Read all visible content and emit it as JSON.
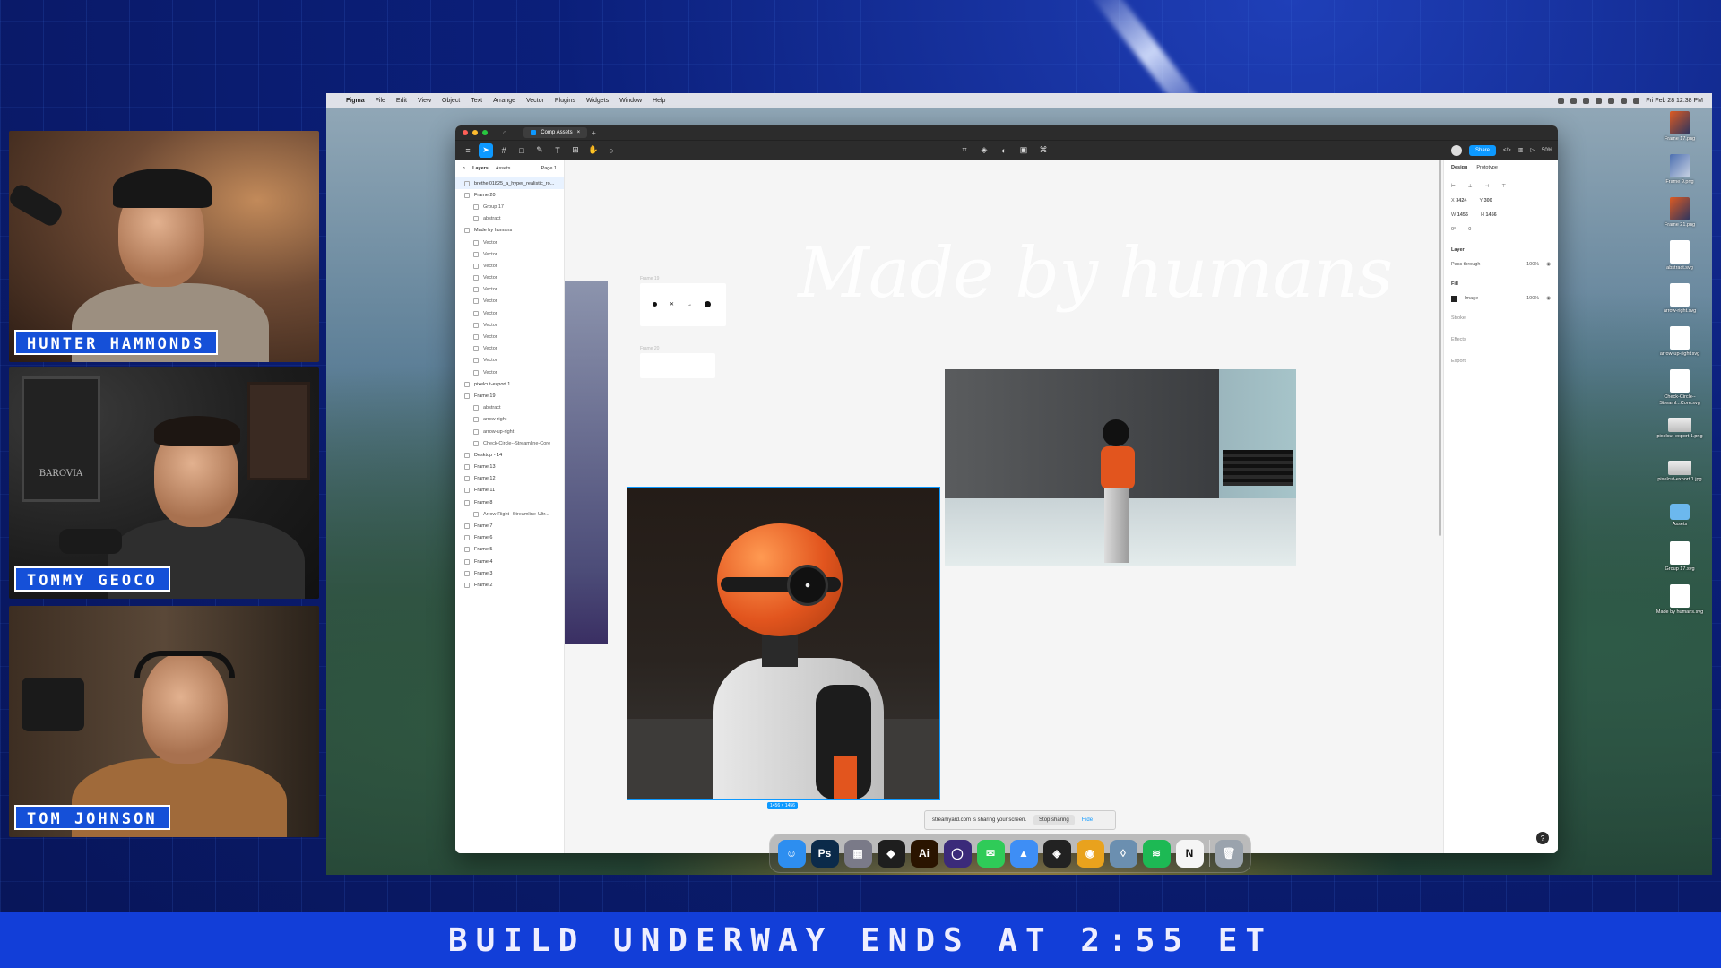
{
  "banner": {
    "text": "BUILD UNDERWAY ENDS AT 2:55 ET"
  },
  "cams": [
    {
      "name": "HUNTER HAMMONDS"
    },
    {
      "name": "TOMMY GEOCO"
    },
    {
      "name": "TOM JOHNSON"
    }
  ],
  "cam_props": {
    "barovia_poster": "BAROVIA"
  },
  "mac_menubar": {
    "app": "Figma",
    "items": [
      "File",
      "Edit",
      "View",
      "Object",
      "Text",
      "Arrange",
      "Vector",
      "Plugins",
      "Widgets",
      "Window",
      "Help"
    ],
    "clock": "Fri Feb 28 12:38 PM"
  },
  "figma": {
    "tab_title": "Comp Assets",
    "share_label": "Share",
    "zoom": "50%",
    "layers_panel": {
      "tabs": [
        "Layers",
        "Assets"
      ],
      "page": "Page 1",
      "rows": [
        {
          "label": "brethel01825_a_hyper_realistic_ro...",
          "level": 0,
          "selected": true
        },
        {
          "label": "Frame 20",
          "level": 0
        },
        {
          "label": "Group 17",
          "level": 1
        },
        {
          "label": "abstract",
          "level": 1
        },
        {
          "label": "Made by humans",
          "level": 0
        },
        {
          "label": "Vector",
          "level": 1
        },
        {
          "label": "Vector",
          "level": 1
        },
        {
          "label": "Vector",
          "level": 1
        },
        {
          "label": "Vector",
          "level": 1
        },
        {
          "label": "Vector",
          "level": 1
        },
        {
          "label": "Vector",
          "level": 1
        },
        {
          "label": "Vector",
          "level": 1
        },
        {
          "label": "Vector",
          "level": 1
        },
        {
          "label": "Vector",
          "level": 1
        },
        {
          "label": "Vector",
          "level": 1
        },
        {
          "label": "Vector",
          "level": 1
        },
        {
          "label": "Vector",
          "level": 1
        },
        {
          "label": "pixelcut-export 1",
          "level": 0
        },
        {
          "label": "Frame 19",
          "level": 0
        },
        {
          "label": "abstract",
          "level": 1
        },
        {
          "label": "arrow-right",
          "level": 1
        },
        {
          "label": "arrow-up-right",
          "level": 1
        },
        {
          "label": "Check-Circle--Streamline-Core",
          "level": 1
        },
        {
          "label": "Desktop - 14",
          "level": 0
        },
        {
          "label": "Frame 13",
          "level": 0
        },
        {
          "label": "Frame 12",
          "level": 0
        },
        {
          "label": "Frame 11",
          "level": 0
        },
        {
          "label": "Frame 8",
          "level": 0
        },
        {
          "label": "Arrow-Right--Streamline-Ultr...",
          "level": 1
        },
        {
          "label": "Frame 7",
          "level": 0
        },
        {
          "label": "Frame 6",
          "level": 0
        },
        {
          "label": "Frame 5",
          "level": 0
        },
        {
          "label": "Frame 4",
          "level": 0
        },
        {
          "label": "Frame 3",
          "level": 0
        },
        {
          "label": "Frame 2",
          "level": 0
        }
      ]
    },
    "canvas": {
      "headline": "Made by humans",
      "frame_label_1": "Frame 19",
      "frame_label_2": "Frame 20",
      "size_badge": "1456 × 1456"
    },
    "properties": {
      "tabs": [
        "Design",
        "Prototype"
      ],
      "x": "3424",
      "y": "300",
      "w": "1456",
      "h": "1456",
      "rotation": "0°",
      "radius": "0",
      "layer_section": "Layer",
      "blend": "Pass through",
      "layer_opacity": "100%",
      "fill_section": "Fill",
      "fill_type": "Image",
      "fill_opacity": "100%",
      "strokes_section": "Stroke",
      "effects_section": "Effects",
      "export_section": "Export"
    }
  },
  "share_bar": {
    "message": "streamyard.com is sharing your screen.",
    "stop": "Stop sharing",
    "hide": "Hide"
  },
  "desktop_icons": [
    {
      "label": "Frame 17.png",
      "kind": "img"
    },
    {
      "label": "Frame 9.png",
      "kind": "img2"
    },
    {
      "label": "Frame 21.png",
      "kind": "img"
    },
    {
      "label": "abstract.svg",
      "kind": "file"
    },
    {
      "label": "arrow-right.svg",
      "kind": "file"
    },
    {
      "label": "arrow-up-right.svg",
      "kind": "file"
    },
    {
      "label": "Check-Circle--Streaml...Core.svg",
      "kind": "file"
    },
    {
      "label": "pixelcut-export 1.png",
      "kind": "wide"
    },
    {
      "label": "pixelcut-export 1.jpg",
      "kind": "wide"
    },
    {
      "label": "Assets",
      "kind": "folder"
    },
    {
      "label": "Group 17.svg",
      "kind": "file"
    },
    {
      "label": "Made by humans.svg",
      "kind": "file"
    }
  ],
  "dock_apps": [
    {
      "name": "finder-app",
      "glyph": "☺",
      "color": "#2d8ef0"
    },
    {
      "name": "photoshop-app",
      "glyph": "Ps",
      "color": "#0b2a4a"
    },
    {
      "name": "launchpad-app",
      "glyph": "▦",
      "color": "#7a7a88"
    },
    {
      "name": "figma-app",
      "glyph": "◆",
      "color": "#1e1e1e"
    },
    {
      "name": "illustrator-app",
      "glyph": "Ai",
      "color": "#2a1400"
    },
    {
      "name": "arc-app",
      "glyph": "◯",
      "color": "#3b2a7a"
    },
    {
      "name": "messages-app",
      "glyph": "✉",
      "color": "#2fcb58"
    },
    {
      "name": "testflight-app",
      "glyph": "▲",
      "color": "#3e8ef5"
    },
    {
      "name": "layers-app",
      "glyph": "◈",
      "color": "#222"
    },
    {
      "name": "chrome-app",
      "glyph": "◉",
      "color": "#e9a21d"
    },
    {
      "name": "preview-app",
      "glyph": "◊",
      "color": "#6b8fb0"
    },
    {
      "name": "spotify-app",
      "glyph": "≋",
      "color": "#1db954"
    },
    {
      "name": "notion-app",
      "glyph": "N",
      "color": "#f5f5f5"
    },
    {
      "name": "trash-app",
      "glyph": "🗑",
      "color": "#9aa3ad"
    }
  ]
}
